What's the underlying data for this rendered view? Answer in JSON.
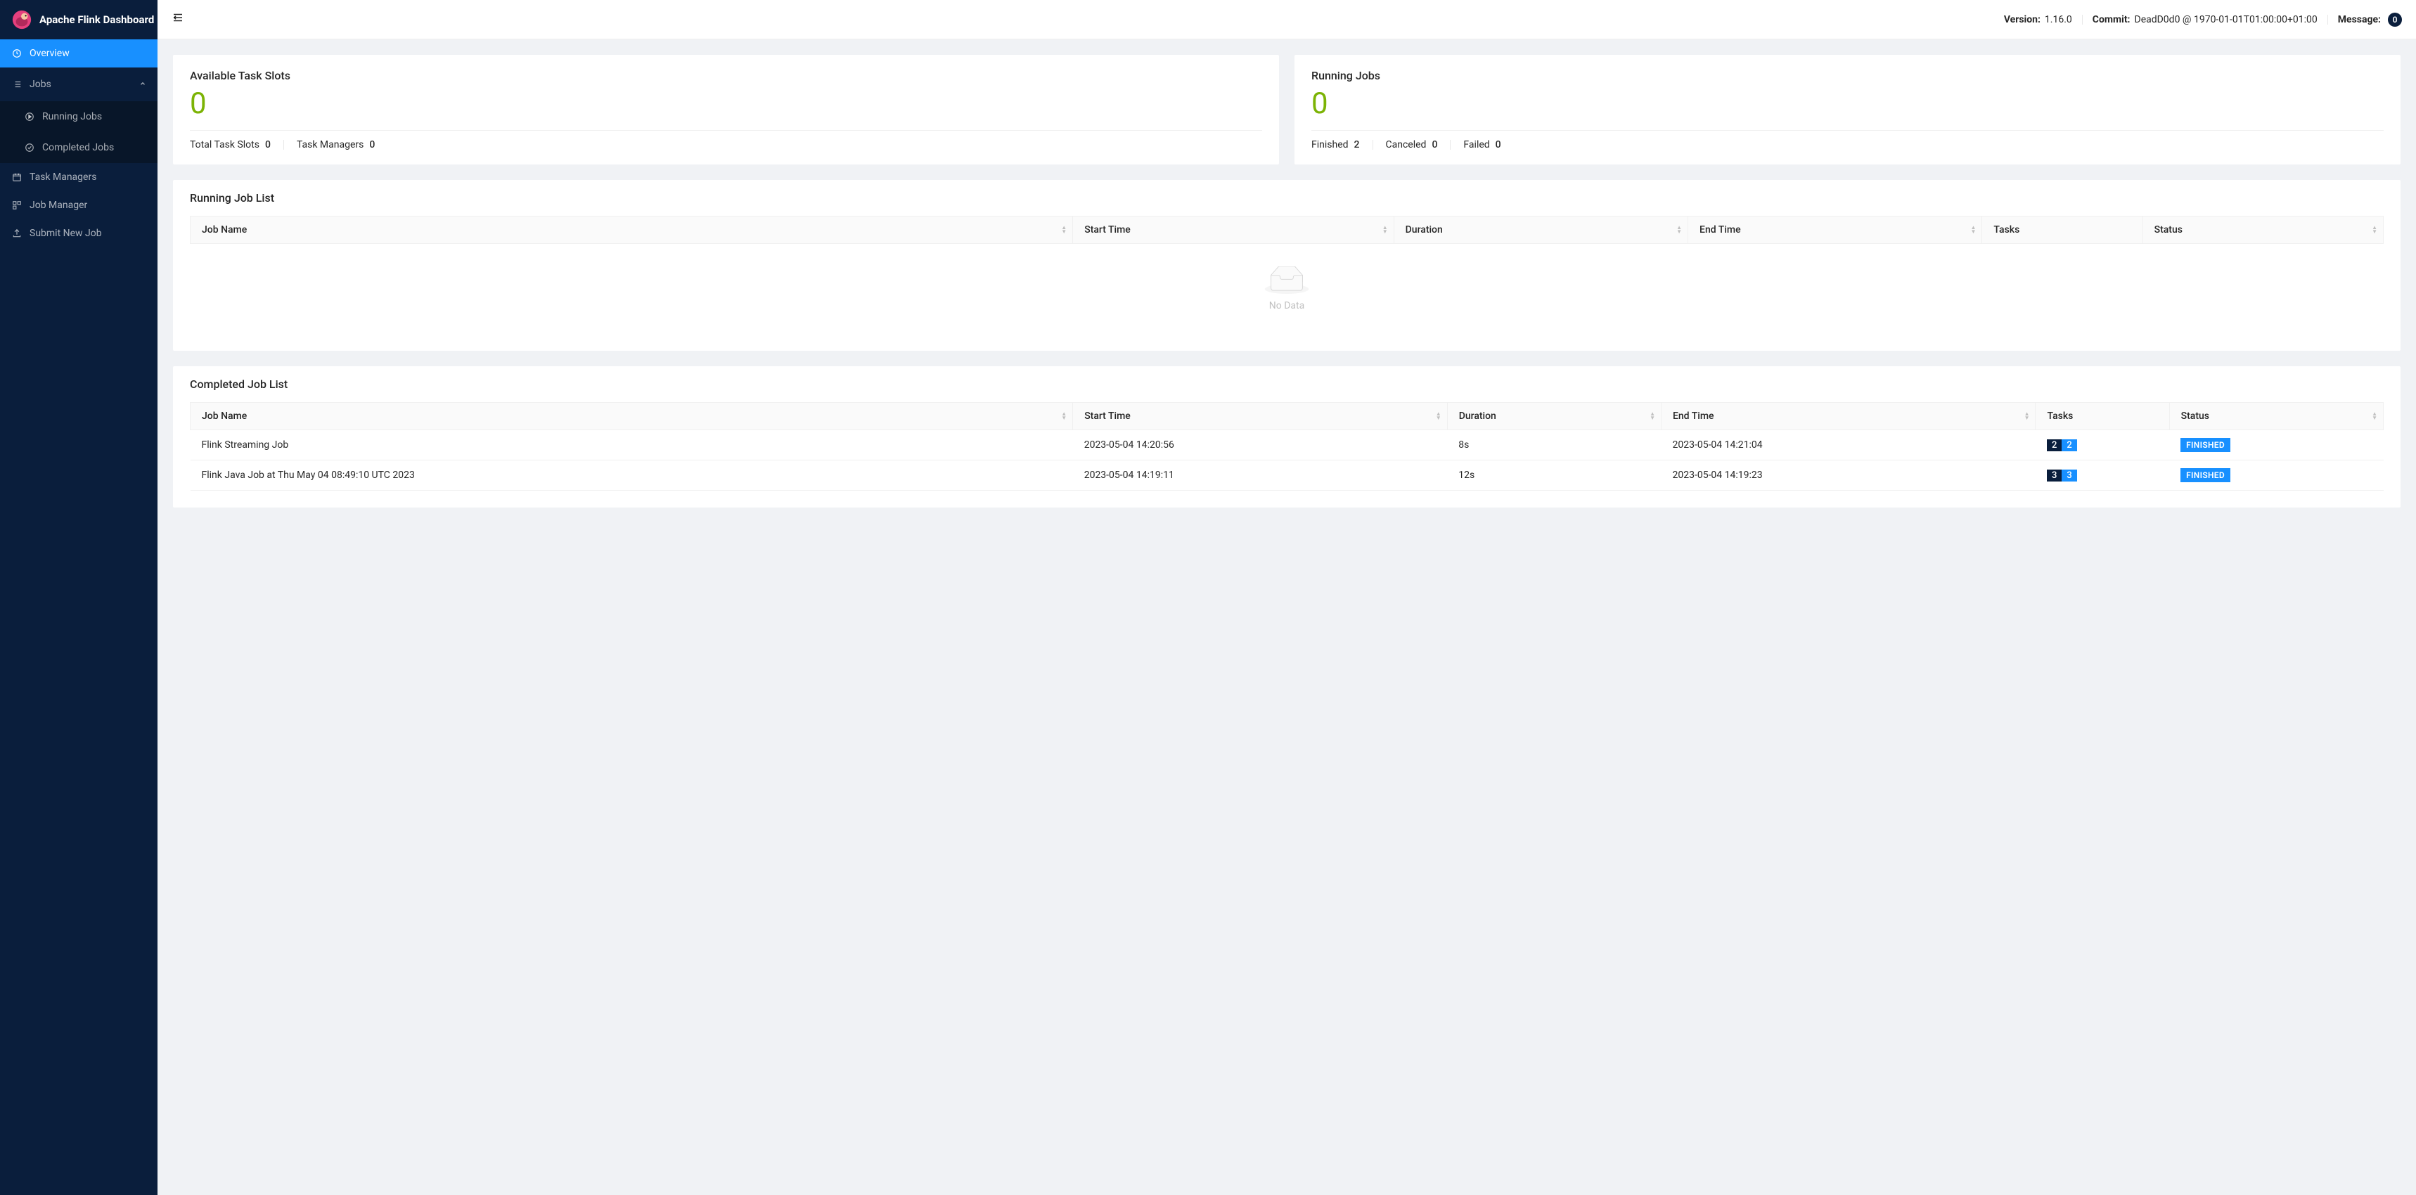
{
  "brand": {
    "title": "Apache Flink Dashboard"
  },
  "sidebar": {
    "overview": "Overview",
    "jobs": "Jobs",
    "running_jobs": "Running Jobs",
    "completed_jobs": "Completed Jobs",
    "task_managers": "Task Managers",
    "job_manager": "Job Manager",
    "submit_new_job": "Submit New Job"
  },
  "header": {
    "version_label": "Version:",
    "version": "1.16.0",
    "commit_label": "Commit:",
    "commit": "DeadD0d0 @ 1970-01-01T01:00:00+01:00",
    "message_label": "Message:",
    "message_count": "0"
  },
  "slots_card": {
    "title": "Available Task Slots",
    "value": "0",
    "total_label": "Total Task Slots",
    "total_value": "0",
    "tm_label": "Task Managers",
    "tm_value": "0"
  },
  "running_card": {
    "title": "Running Jobs",
    "value": "0",
    "finished_label": "Finished",
    "finished_value": "2",
    "canceled_label": "Canceled",
    "canceled_value": "0",
    "failed_label": "Failed",
    "failed_value": "0"
  },
  "running_list": {
    "title": "Running Job List",
    "empty": "No Data"
  },
  "columns": {
    "job_name": "Job Name",
    "start_time": "Start Time",
    "duration": "Duration",
    "end_time": "End Time",
    "tasks": "Tasks",
    "status": "Status"
  },
  "completed_list": {
    "title": "Completed Job List",
    "rows": [
      {
        "name": "Flink Streaming Job",
        "start": "2023-05-04 14:20:56",
        "duration": "8s",
        "end": "2023-05-04 14:21:04",
        "tasks_a": "2",
        "tasks_b": "2",
        "status": "FINISHED"
      },
      {
        "name": "Flink Java Job at Thu May 04 08:49:10 UTC 2023",
        "start": "2023-05-04 14:19:11",
        "duration": "12s",
        "end": "2023-05-04 14:19:23",
        "tasks_a": "3",
        "tasks_b": "3",
        "status": "FINISHED"
      }
    ]
  }
}
